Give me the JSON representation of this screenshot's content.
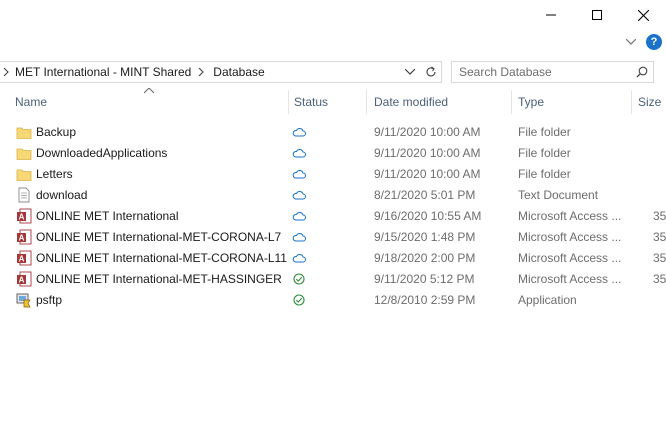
{
  "breadcrumb": {
    "items": [
      "MET International - MINT Shared",
      "Database"
    ]
  },
  "search": {
    "placeholder": "Search Database"
  },
  "columns": {
    "name": "Name",
    "status": "Status",
    "date": "Date modified",
    "type": "Type",
    "size": "Size"
  },
  "files": [
    {
      "name": "Backup",
      "icon": "folder-icon",
      "status": "cloud-icon",
      "date": "9/11/2020 10:00 AM",
      "type": "File folder",
      "size": ""
    },
    {
      "name": "DownloadedApplications",
      "icon": "folder-icon",
      "status": "cloud-icon",
      "date": "9/11/2020 10:00 AM",
      "type": "File folder",
      "size": ""
    },
    {
      "name": "Letters",
      "icon": "folder-icon",
      "status": "cloud-icon",
      "date": "9/11/2020 10:00 AM",
      "type": "File folder",
      "size": ""
    },
    {
      "name": "download",
      "icon": "text-document-icon",
      "status": "cloud-icon",
      "date": "8/21/2020 5:01 PM",
      "type": "Text Document",
      "size": ""
    },
    {
      "name": "ONLINE MET International",
      "icon": "access-database-icon",
      "status": "cloud-icon",
      "date": "9/16/2020 10:55 AM",
      "type": "Microsoft Access ...",
      "size": "35"
    },
    {
      "name": "ONLINE MET International-MET-CORONA-L7",
      "icon": "access-database-icon",
      "status": "cloud-icon",
      "date": "9/15/2020 1:48 PM",
      "type": "Microsoft Access ...",
      "size": "35"
    },
    {
      "name": "ONLINE MET International-MET-CORONA-L11",
      "icon": "access-database-icon",
      "status": "cloud-icon",
      "date": "9/18/2020 2:00 PM",
      "type": "Microsoft Access ...",
      "size": "35"
    },
    {
      "name": "ONLINE MET International-MET-HASSINGER",
      "icon": "access-database-icon",
      "status": "synced-check-icon",
      "date": "9/11/2020 5:12 PM",
      "type": "Microsoft Access ...",
      "size": "35"
    },
    {
      "name": "psftp",
      "icon": "application-icon",
      "status": "synced-check-icon",
      "date": "12/8/2010 2:59 PM",
      "type": "Application",
      "size": ""
    }
  ],
  "colors": {
    "cloud": "#1a73c8",
    "synced": "#2e8b3a",
    "folder": "#f8d775",
    "header_text": "#4c607a"
  }
}
